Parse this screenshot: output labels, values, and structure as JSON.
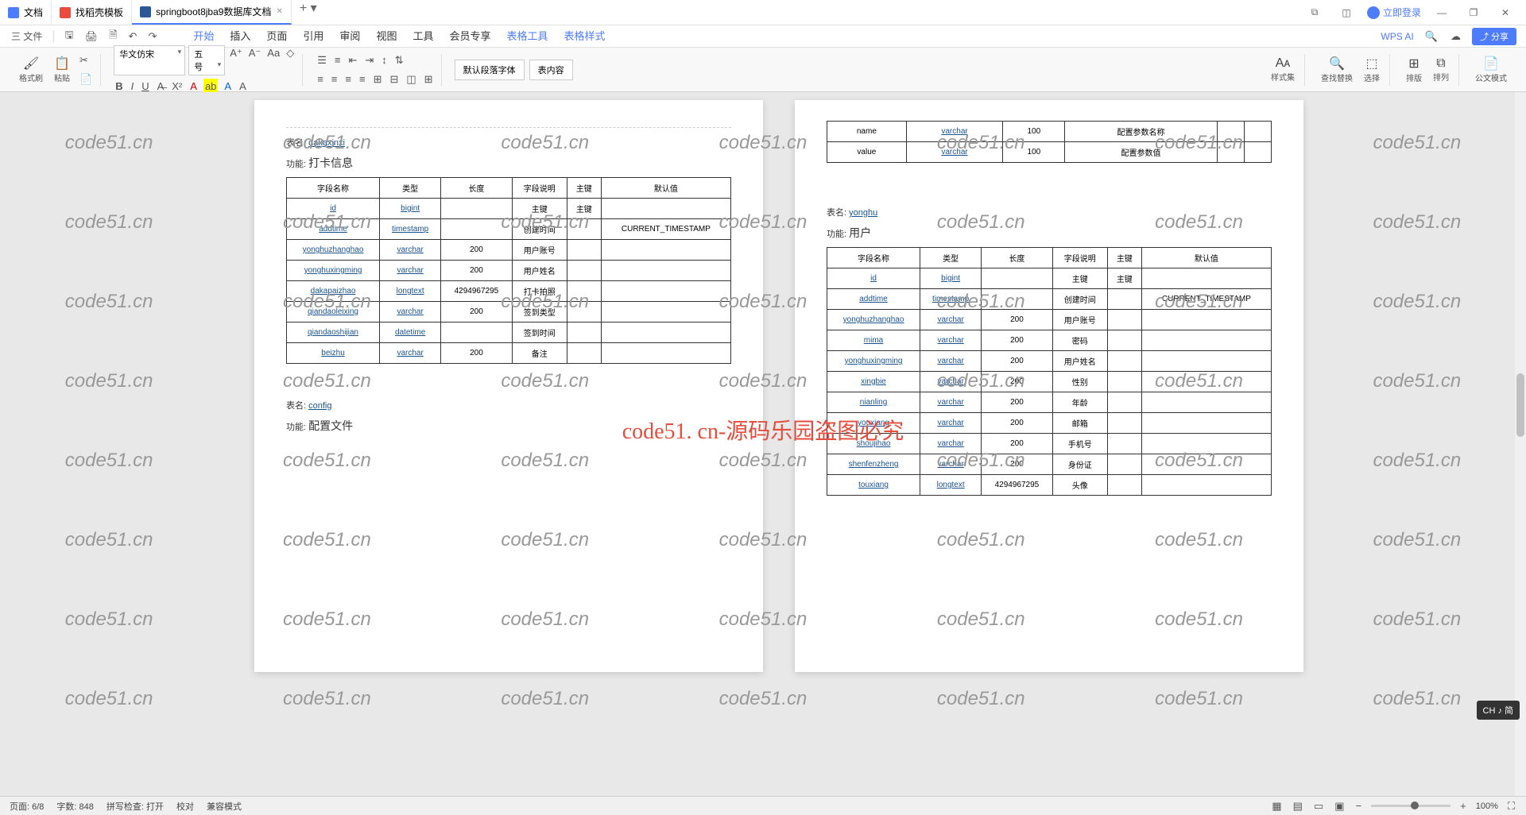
{
  "tabs": [
    {
      "label": "文档",
      "icon": "blue"
    },
    {
      "label": "找稻壳模板",
      "icon": "red"
    },
    {
      "label": "springboot8jba9数据库文档",
      "icon": "word",
      "active": true
    }
  ],
  "login": "立即登录",
  "menubar": {
    "file": "三 文件"
  },
  "menu_tabs": [
    "开始",
    "插入",
    "页面",
    "引用",
    "审阅",
    "视图",
    "工具",
    "会员专享"
  ],
  "ctx_tabs": [
    "表格工具",
    "表格样式"
  ],
  "ai": "WPS AI",
  "share": "分享",
  "ribbon": {
    "format_painter": "格式刷",
    "paste": "粘贴",
    "font": "华文仿宋",
    "size": "五号",
    "para_font": "默认段落字体",
    "body": "表内容",
    "styles": "样式集",
    "find": "查找替换",
    "select": "选择",
    "layout": "排版",
    "arrange": "排列",
    "gov": "公文模式"
  },
  "page_left": {
    "table1_name_label": "表名:",
    "table1_name": "dakaxinxi",
    "table1_func_label": "功能:",
    "table1_func": "打卡信息",
    "headers": [
      "字段名称",
      "类型",
      "长度",
      "字段说明",
      "主键",
      "默认值"
    ],
    "rows": [
      [
        "id",
        "bigint",
        "",
        "主键",
        "主键",
        ""
      ],
      [
        "addtime",
        "timestamp",
        "",
        "创建时间",
        "",
        "CURRENT_TIMESTAMP"
      ],
      [
        "yonghuzhanghao",
        "varchar",
        "200",
        "用户账号",
        "",
        ""
      ],
      [
        "yonghuxingming",
        "varchar",
        "200",
        "用户姓名",
        "",
        ""
      ],
      [
        "dakapaizhao",
        "longtext",
        "4294967295",
        "打卡拍照",
        "",
        ""
      ],
      [
        "qiandaoleixing",
        "varchar",
        "200",
        "签到类型",
        "",
        ""
      ],
      [
        "qiandaoshijian",
        "datetime",
        "",
        "签到时间",
        "",
        ""
      ],
      [
        "beizhu",
        "varchar",
        "200",
        "备注",
        "",
        ""
      ]
    ],
    "table2_name_label": "表名:",
    "table2_name": "config",
    "table2_func_label": "功能:",
    "table2_func": "配置文件"
  },
  "page_right": {
    "top_rows": [
      [
        "name",
        "varchar",
        "100",
        "配置参数名称",
        "",
        ""
      ],
      [
        "value",
        "varchar",
        "100",
        "配置参数值",
        "",
        ""
      ]
    ],
    "table_name_label": "表名:",
    "table_name": "yonghu",
    "table_func_label": "功能:",
    "table_func": "用户",
    "headers": [
      "字段名称",
      "类型",
      "长度",
      "字段说明",
      "主键",
      "默认值"
    ],
    "rows": [
      [
        "id",
        "bigint",
        "",
        "主键",
        "主键",
        ""
      ],
      [
        "addtime",
        "timestamp",
        "",
        "创建时间",
        "",
        "CURRENT_TIMESTAMP"
      ],
      [
        "yonghuzhanghao",
        "varchar",
        "200",
        "用户账号",
        "",
        ""
      ],
      [
        "mima",
        "varchar",
        "200",
        "密码",
        "",
        ""
      ],
      [
        "yonghuxingming",
        "varchar",
        "200",
        "用户姓名",
        "",
        ""
      ],
      [
        "xingbie",
        "varchar",
        "200",
        "性别",
        "",
        ""
      ],
      [
        "nianling",
        "varchar",
        "200",
        "年龄",
        "",
        ""
      ],
      [
        "youxiang",
        "varchar",
        "200",
        "邮箱",
        "",
        ""
      ],
      [
        "shoujihao",
        "varchar",
        "200",
        "手机号",
        "",
        ""
      ],
      [
        "shenfenzheng",
        "varchar",
        "200",
        "身份证",
        "",
        ""
      ],
      [
        "touxiang",
        "longtext",
        "4294967295",
        "头像",
        "",
        ""
      ]
    ]
  },
  "watermark": "code51.cn",
  "red_notice": "code51. cn-源码乐园盗图必究",
  "status": {
    "page": "页面: 6/8",
    "words": "字数: 848",
    "spell": "拼写检查: 打开",
    "proof": "校对",
    "compat": "兼容模式",
    "zoom": "100%"
  },
  "ime": "CH ♪ 简"
}
